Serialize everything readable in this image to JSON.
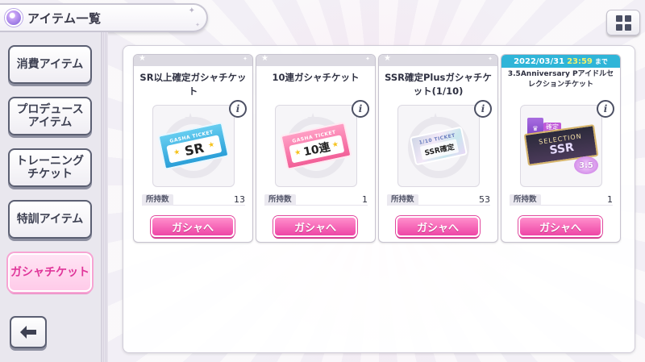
{
  "header": {
    "title": "アイテム一覧"
  },
  "sidebar": {
    "items": [
      {
        "label": "消費アイテム",
        "active": false
      },
      {
        "label": "プロデュース\nアイテム",
        "active": false
      },
      {
        "label": "トレーニング\nチケット",
        "active": false
      },
      {
        "label": "特訓アイテム",
        "active": false
      },
      {
        "label": "ガシャチケット",
        "active": true
      }
    ],
    "back_icon": "arrow-left-icon"
  },
  "grid_icon": "grid-view-icon",
  "cards": [
    {
      "name": "SR以上確定ガシャチケット",
      "ticket_caption": "GASHA TICKET",
      "ticket_text": "SR",
      "count_label": "所持数",
      "count": "13",
      "button_label": "ガシャへ"
    },
    {
      "name": "10連ガシャチケット",
      "ticket_caption": "GASHA TICKET",
      "ticket_text": "10連",
      "count_label": "所持数",
      "count": "1",
      "button_label": "ガシャへ"
    },
    {
      "name": "SSR確定Plusガシャチケット(1/10)",
      "ticket_caption": "1/10 TICKET",
      "ticket_text": "SSR確定",
      "count_label": "所持数",
      "count": "53",
      "button_label": "ガシャへ"
    },
    {
      "name": "3.5Anniversary Pアイドルセレクションチケット",
      "deadline_date": "2022/03/31",
      "deadline_time": "23:59",
      "deadline_suffix": "まで",
      "ticket_tag": "確定",
      "ticket_caption": "SELECTION",
      "ticket_text": "SSR",
      "ticket_badge": "3.5",
      "count_label": "所持数",
      "count": "1",
      "button_label": "ガシャへ"
    }
  ],
  "colors": {
    "accent_pink": "#ee46a6",
    "active_tab_text": "#e0369a",
    "deadline_bg": "#2fb5d8",
    "deadline_time": "#f3f26a"
  }
}
